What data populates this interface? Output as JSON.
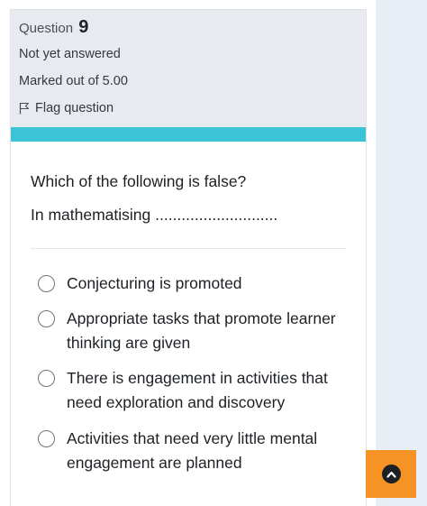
{
  "question_info": {
    "label": "Question",
    "number": "9",
    "status": "Not yet answered",
    "marks": "Marked out of 5.00",
    "flag_label": "Flag question"
  },
  "question": {
    "prompt": "Which of the following is false?",
    "stem": "In mathematising ............................",
    "options": [
      {
        "label": "Conjecturing is promoted",
        "selected": false
      },
      {
        "label": "Appropriate tasks that promote learner thinking are given",
        "selected": false
      },
      {
        "label": "There is engagement in activities that need exploration and discovery",
        "selected": false
      },
      {
        "label": "Activities that need very little mental engagement are planned",
        "selected": false
      }
    ]
  },
  "icons": {
    "flag": "flag-icon",
    "scroll_top": "chevron-up-icon"
  },
  "colors": {
    "info_background": "#e7eaee",
    "accent_bar": "#3bc3d6",
    "scroll_button": "#f79325",
    "side_panel": "#e7eef6"
  }
}
